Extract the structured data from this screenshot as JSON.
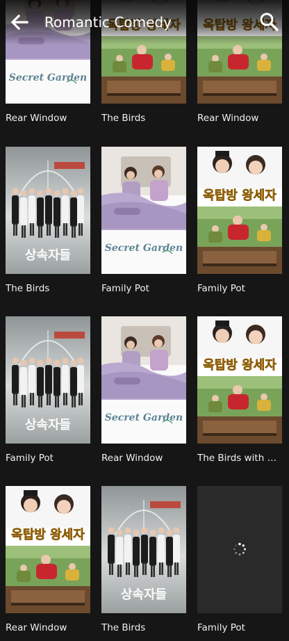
{
  "header": {
    "title": "Romantic Comedy",
    "back_icon": "arrow-left-icon",
    "search_icon": "search-icon"
  },
  "colors": {
    "background": "#161616",
    "text": "#f0f0f0",
    "loading_tile": "#2a2a2a"
  },
  "poster_texts": {
    "secret_garden": "Secret Garden",
    "rooftop_prince": "옥탑방 왕세자",
    "heirs": "상속자들"
  },
  "grid": {
    "items": [
      {
        "label": "Rear Window",
        "poster": "secret-garden"
      },
      {
        "label": "The Birds",
        "poster": "rooftop-prince"
      },
      {
        "label": "Rear Window",
        "poster": "rooftop-prince"
      },
      {
        "label": "The Birds",
        "poster": "heirs"
      },
      {
        "label": "Family Pot",
        "poster": "secret-garden"
      },
      {
        "label": "Family Pot",
        "poster": "rooftop-prince"
      },
      {
        "label": "Family Pot",
        "poster": "heirs"
      },
      {
        "label": "Rear Window",
        "poster": "secret-garden"
      },
      {
        "label": "The Birds with an...",
        "poster": "rooftop-prince"
      },
      {
        "label": "Rear Window",
        "poster": "rooftop-prince"
      },
      {
        "label": "The Birds",
        "poster": "heirs"
      },
      {
        "label": "Family Pot",
        "poster": "loading"
      }
    ]
  }
}
